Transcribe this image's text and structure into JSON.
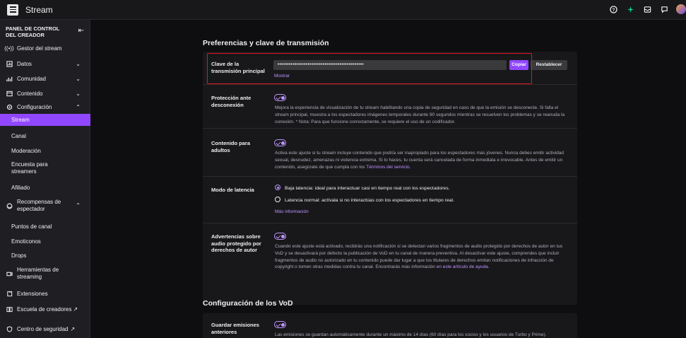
{
  "topbar": {
    "title": "Stream",
    "icons": [
      "help-icon",
      "sparkle-icon",
      "inbox-icon",
      "whispers-icon",
      "avatar"
    ]
  },
  "sidebar": {
    "header": "PANEL DE CONTROL DEL CREADOR",
    "items": [
      {
        "label": "Gestor del stream",
        "icon": "stream-manager-icon"
      },
      {
        "label": "Datos",
        "icon": "data-icon",
        "chevron": "down"
      },
      {
        "label": "Comunidad",
        "icon": "community-icon",
        "chevron": "down"
      },
      {
        "label": "Contenido",
        "icon": "content-icon",
        "chevron": "down"
      },
      {
        "label": "Configuración",
        "icon": "settings-icon",
        "chevron": "up"
      },
      {
        "label": "Stream",
        "active": true
      },
      {
        "label": "Canal"
      },
      {
        "label": "Moderación"
      },
      {
        "label": "Encuesta para streamers"
      },
      {
        "label": "Afiliado"
      },
      {
        "label": "Recompensas de espectador",
        "icon": "rewards-icon",
        "chevron": "up"
      },
      {
        "label": "Puntos de canal"
      },
      {
        "label": "Emoticonos"
      },
      {
        "label": "Drops"
      },
      {
        "label": "Herramientas de streaming",
        "icon": "tools-icon"
      },
      {
        "label": "Extensiones",
        "icon": "extensions-icon"
      },
      {
        "label": "Escuela de creadores",
        "icon": "school-icon"
      },
      {
        "label": "Centro de seguridad",
        "icon": "shield-icon"
      }
    ]
  },
  "preferences": {
    "title": "Preferencias y clave de transmisión",
    "stream_key": {
      "label": "Clave de la transmisión principal",
      "value": "••••••••••••••••••••••••••••••••••••••••••••••",
      "copy": "Copiar",
      "reset": "Restablecer",
      "show": "Mostrar"
    },
    "disconnect": {
      "label": "Protección ante desconexión",
      "text": "Mejora la experiencia de visualización de tu stream habilitando una copia de seguridad en caso de que la emisión se desconecte. Si falla el stream principal, muestra a los espectadores imágenes temporales durante 90 segundos mientras se resuelven los problemas y se reanuda la conexión. * Nota: Para que funcione correctamente, se requiere el uso de un codificador."
    },
    "adult": {
      "label": "Contenido para adultos",
      "text": "Activa este ajuste si tu stream incluye contenido que podría ser inapropiado para los espectadores más jóvenes. Nunca debes emitir actividad sexual, desnudez, amenazas ni violencia extrema. Si lo haces, tu cuenta será cancelada de forma inmediata e irrevocable. Antes de emitir un contenido, asegúrate de que cumpla con los",
      "link": "Términos del servicio."
    },
    "latency": {
      "label": "Modo de latencia",
      "low": "Baja latencia: ideal para interactuar casi en tiempo real con los espectadores.",
      "normal": "Latencia normal: actívala si no interactúas con los espectadores en tiempo real.",
      "more": "Más información"
    },
    "copyright": {
      "label": "Advertencias sobre audio protegido por derechos de autor",
      "text": "Cuando este ajuste está activado, recibirás una notificación si se detectan varios fragmentos de audio protegido por derechos de autor en tus VoD y se desactivará por defecto la publicación de VoD en tu canal de manera preventiva. Al desactivar este ajuste, comprendes que incluir fragmentos de audio no autorizado en tu contenido puede dar lugar a que los titulares de derechos emitan notificaciones de infracción de copyright o tomen otras medidas contra tu canal. Encontrarás más información",
      "link": "en este artículo de ayuda."
    }
  },
  "vod": {
    "title": "Configuración de los VoD",
    "save_past": {
      "label": "Guardar emisiones anteriores",
      "text": "Las emisiones se guardan automáticamente durante un máximo de 14 días (60 días para los socios y los usuarios de Turbo y Prime)."
    }
  },
  "colors": {
    "accent": "#9147ff",
    "link": "#bf94ff",
    "highlight": "#e5131e"
  }
}
